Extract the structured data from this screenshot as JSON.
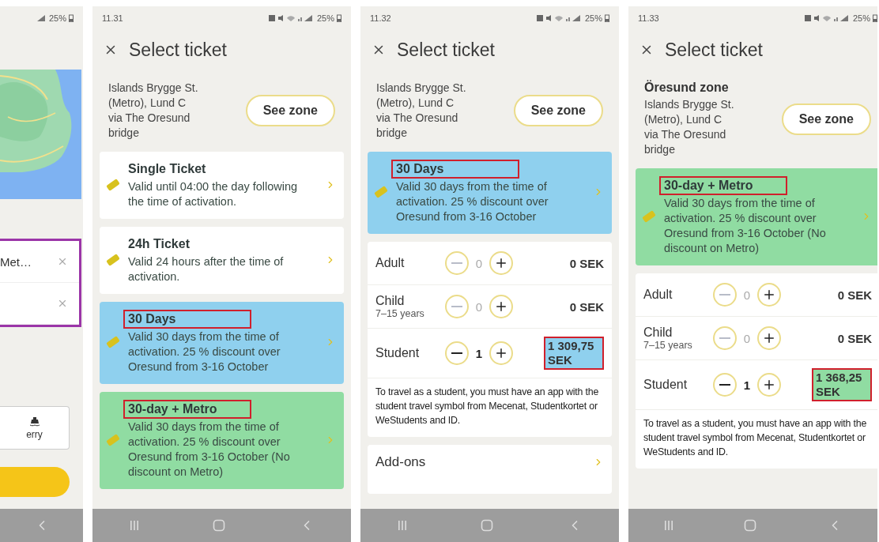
{
  "left_panel": {
    "battery": "25%",
    "rows": [
      {
        "kind": "text",
        "label": "Met…"
      },
      {
        "kind": "empty"
      }
    ],
    "mode_button": {
      "label": "erry"
    }
  },
  "screens": [
    {
      "time": "11.31",
      "battery": "25%",
      "title": "Select ticket",
      "route": [
        "Islands Brygge St.",
        "(Metro), Lund C",
        "via The Oresund",
        "bridge"
      ],
      "zone_button": "See zone",
      "tickets": [
        {
          "name": "Single Ticket",
          "description": "Valid until 04:00 the day following the time of activation.",
          "color": "#ffffff",
          "annotated": false
        },
        {
          "name": "24h Ticket",
          "description": "Valid 24 hours after the time of activation.",
          "color": "#ffffff",
          "annotated": false
        },
        {
          "name": "30 Days",
          "description": "Valid 30 days from the time of activation. 25 % discount over Oresund from 3-16 October",
          "color": "#8fd0ee",
          "annotated": true
        },
        {
          "name": "30-day + Metro",
          "description": "Valid 30 days from the time of activation. 25 % discount over Oresund from 3-16 October (No discount on Metro)",
          "color": "#90dca2",
          "annotated": true
        }
      ]
    },
    {
      "time": "11.32",
      "battery": "25%",
      "title": "Select ticket",
      "route": [
        "Islands Brygge St.",
        "(Metro), Lund C",
        "via The Oresund",
        "bridge"
      ],
      "zone_button": "See zone",
      "tickets": [
        {
          "name": "30 Days",
          "description": "Valid 30 days from the time of activation. 25 % discount over Oresund from 3-16 October",
          "color": "#8fd0ee",
          "annotated": true
        }
      ],
      "passengers": [
        {
          "label": "Adult",
          "count": "0",
          "price": "0 SEK",
          "minus_disabled": true,
          "annotated": false
        },
        {
          "label": "Child",
          "sublabel": "7–15 years",
          "count": "0",
          "price": "0 SEK",
          "minus_disabled": true,
          "annotated": false
        },
        {
          "label": "Student",
          "count": "1",
          "price": "1 309,75 SEK",
          "minus_disabled": false,
          "annotated": true,
          "color": "#8fd0ee"
        }
      ],
      "note": "To travel as a student, you must have an app with the student travel symbol from Mecenat, Studentkortet or WeStudents and ID.",
      "addons": {
        "label": "Add-ons"
      }
    },
    {
      "time": "11.33",
      "battery": "25%",
      "title": "Select ticket",
      "zone_title": "Öresund zone",
      "route": [
        "Islands Brygge St.",
        "(Metro), Lund C",
        "via The Oresund",
        "bridge"
      ],
      "zone_button": "See zone",
      "tickets": [
        {
          "name": "30-day + Metro",
          "description": "Valid 30 days from the time of activation. 25 % discount over Oresund from 3-16 October (No discount on Metro)",
          "color": "#90dca2",
          "annotated": true
        }
      ],
      "passengers": [
        {
          "label": "Adult",
          "count": "0",
          "price": "0 SEK",
          "minus_disabled": true,
          "annotated": false
        },
        {
          "label": "Child",
          "sublabel": "7–15 years",
          "count": "0",
          "price": "0 SEK",
          "minus_disabled": true,
          "annotated": false
        },
        {
          "label": "Student",
          "count": "1",
          "price": "1 368,25 SEK",
          "minus_disabled": false,
          "annotated": true,
          "color": "#90dca2"
        }
      ],
      "note": "To travel as a student, you must have an app with the student travel symbol from Mecenat, Studentkortet or WeStudents and ID."
    }
  ]
}
